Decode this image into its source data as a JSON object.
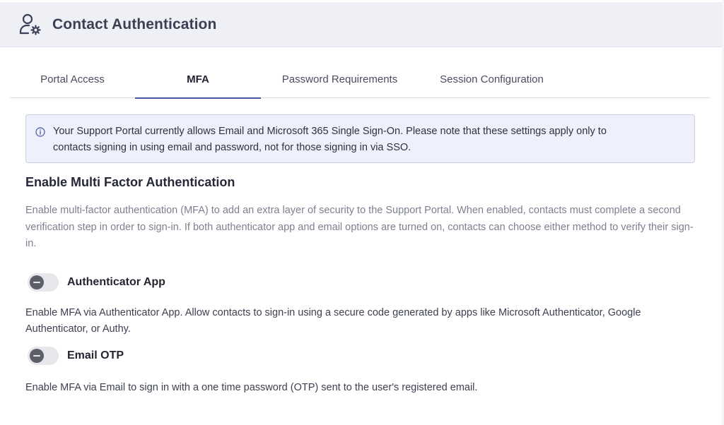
{
  "header": {
    "title": "Contact Authentication",
    "icon": "user-settings-icon"
  },
  "tabs": [
    {
      "label": "Portal Access",
      "active": false
    },
    {
      "label": "MFA",
      "active": true
    },
    {
      "label": "Password Requirements",
      "active": false
    },
    {
      "label": "Session Configuration",
      "active": false
    }
  ],
  "info": {
    "icon": "info-icon",
    "line1": "Your Support Portal currently allows Email and Microsoft 365 Single Sign-On. Please note that these settings apply only to",
    "line2": "contacts signing in using email and password, not for those signing in via SSO."
  },
  "section": {
    "title": "Enable Multi Factor Authentication",
    "description": "Enable multi-factor authentication (MFA) to add an extra layer of security to the Support Portal. When enabled, contacts must complete a second verification step in order to sign-in. If both authenticator app and email options are turned on, contacts can choose either method to verify their sign-in."
  },
  "options": [
    {
      "label": "Authenticator App",
      "enabled": false,
      "description": "Enable MFA via Authenticator App. Allow contacts to sign-in using a secure code generated by apps like Microsoft Authenticator, Google Authenticator, or Authy."
    },
    {
      "label": "Email OTP",
      "enabled": false,
      "description": "Enable MFA via Email to sign in with a one time password (OTP) sent to the user's registered email."
    }
  ],
  "colors": {
    "accent": "#4a56a0",
    "header_bg": "#eef0f5",
    "info_bg": "#eef1fb"
  }
}
